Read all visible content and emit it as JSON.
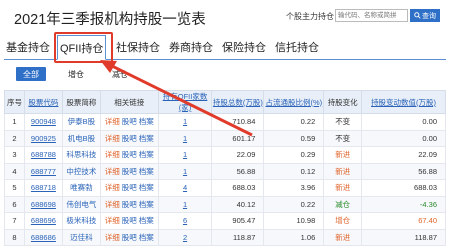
{
  "page": {
    "title": "2021年三季报机构持股一览表"
  },
  "search": {
    "label": "个股主力持仓",
    "placeholder": "输代码、名称或简拼",
    "button": "查询"
  },
  "tabs": [
    {
      "label": "基金持仓"
    },
    {
      "label": "QFII持仓"
    },
    {
      "label": "社保持仓"
    },
    {
      "label": "券商持仓"
    },
    {
      "label": "保险持仓"
    },
    {
      "label": "信托持仓"
    }
  ],
  "filters": [
    {
      "label": "全部"
    },
    {
      "label": "增仓"
    },
    {
      "label": "减仓"
    }
  ],
  "table": {
    "headers": [
      "序号",
      "股票代码",
      "股票简称",
      "相关链接",
      "持有QFII家数(家)",
      "持股总数(万股)",
      "占流通股比例(%)",
      "持股变化",
      "持股变动数值(万股)"
    ],
    "links": {
      "detail": "详细",
      "forum": "股吧",
      "archive": "档案"
    },
    "rows": [
      {
        "no": "1",
        "code": "900948",
        "name": "伊泰B股",
        "count": "1",
        "total": "710.84",
        "ratio": "0.22",
        "change": "不变",
        "delta": "0.00"
      },
      {
        "no": "2",
        "code": "900925",
        "name": "机电B股",
        "count": "1",
        "total": "601.17",
        "ratio": "0.59",
        "change": "不变",
        "delta": "0.00"
      },
      {
        "no": "3",
        "code": "688788",
        "name": "科思科技",
        "count": "1",
        "total": "22.09",
        "ratio": "0.29",
        "change": "新进",
        "delta": "22.09"
      },
      {
        "no": "4",
        "code": "688777",
        "name": "中控技术",
        "count": "1",
        "total": "56.88",
        "ratio": "0.12",
        "change": "新进",
        "delta": "56.88"
      },
      {
        "no": "5",
        "code": "688718",
        "name": "唯赛勃",
        "count": "4",
        "total": "688.03",
        "ratio": "3.96",
        "change": "新进",
        "delta": "688.03"
      },
      {
        "no": "6",
        "code": "688698",
        "name": "伟创电气",
        "count": "1",
        "total": "40.12",
        "ratio": "0.22",
        "change": "减仓",
        "delta": "-4.36"
      },
      {
        "no": "7",
        "code": "688696",
        "name": "极米科技",
        "count": "6",
        "total": "905.47",
        "ratio": "10.98",
        "change": "增仓",
        "delta": "67.40"
      },
      {
        "no": "8",
        "code": "688686",
        "name": "迈佳科",
        "count": "2",
        "total": "118.87",
        "ratio": "1.06",
        "change": "新进",
        "delta": "118.87"
      }
    ]
  },
  "colors": {
    "accent": "#2e6fc7",
    "highlight": "#e03a2a"
  }
}
